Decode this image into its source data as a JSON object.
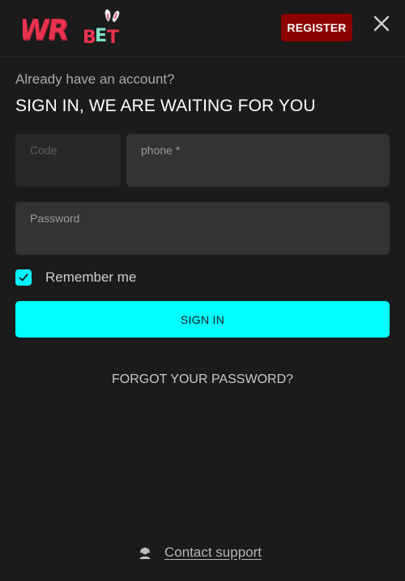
{
  "header": {
    "logo_text": "WRBET",
    "register_label": "REGISTER",
    "close_icon": "close-icon"
  },
  "login": {
    "subtitle": "Already have an account?",
    "title": "SIGN IN, WE ARE WAITING FOR YOU",
    "code_label": "Code",
    "code_value": "",
    "phone_label": "phone *",
    "phone_value": "",
    "password_label": "Password",
    "password_value": "",
    "remember_label": "Remember me",
    "remember_checked": true,
    "signin_label": "SIGN IN",
    "forgot_label": "FORGOT YOUR PASSWORD?"
  },
  "footer": {
    "support_icon": "support-agent-icon",
    "support_label": "Contact support"
  },
  "colors": {
    "background": "#1b1b1b",
    "accent": "#00ffff",
    "register": "#8b0000",
    "field": "#333333",
    "logo_red": "#e8334f",
    "logo_mint": "#7fe3c9"
  }
}
